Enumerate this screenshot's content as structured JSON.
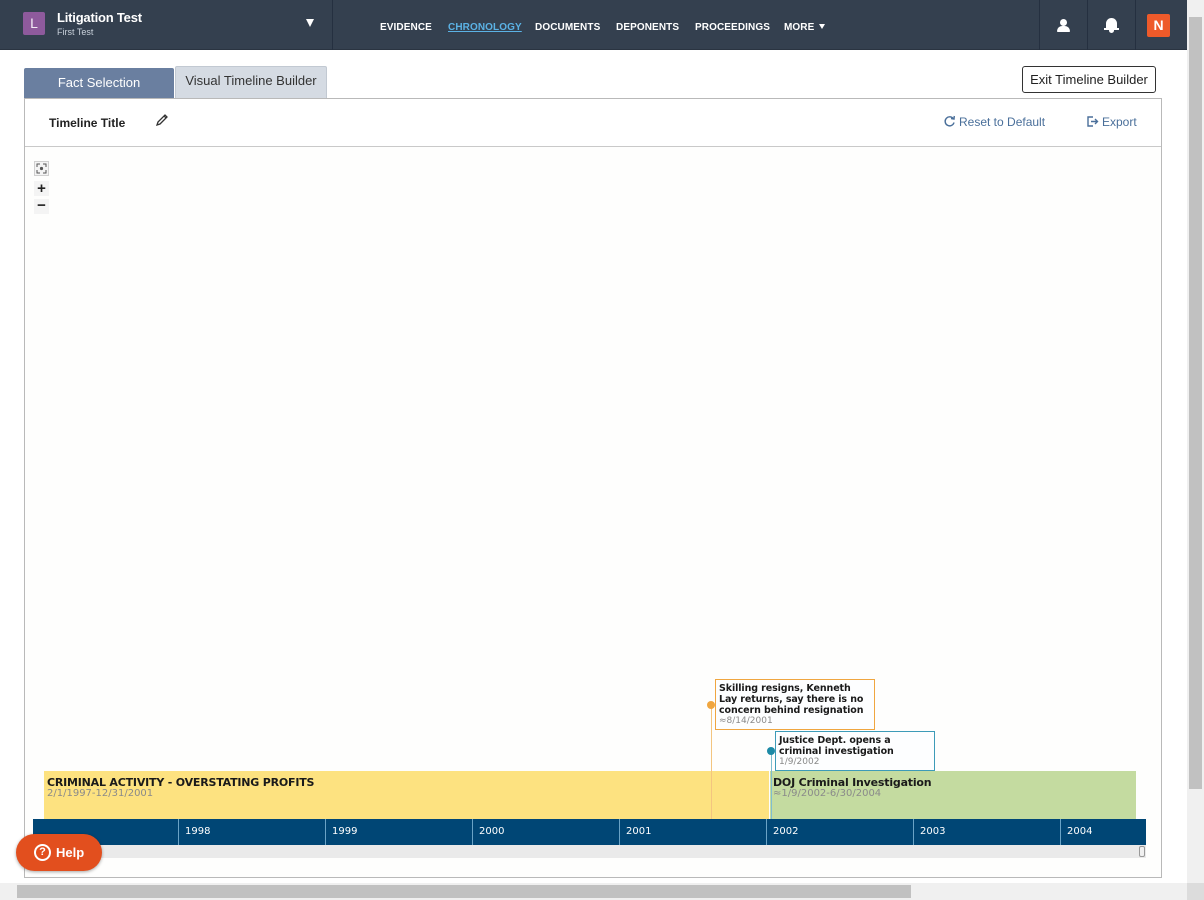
{
  "case": {
    "initial": "L",
    "name": "Litigation Test",
    "subtitle": "First Test"
  },
  "nav": {
    "items": [
      "EVIDENCE",
      "CHRONOLOGY",
      "DOCUMENTS",
      "DEPONENTS",
      "PROCEEDINGS",
      "MORE"
    ],
    "active": "CHRONOLOGY"
  },
  "header_icons": [
    "user-icon",
    "bell-icon",
    "brand-logo-icon"
  ],
  "brand_glyph": "N",
  "tabs": {
    "fact_selection": "Fact Selection",
    "visual_timeline_builder": "Visual Timeline Builder"
  },
  "exit_button": "Exit Timeline Builder",
  "toolbar": {
    "timeline_title": "Timeline Title",
    "reset_label": "Reset to Default",
    "export_label": "Export"
  },
  "zoom": {
    "in_label": "+",
    "out_label": "−"
  },
  "timeline": {
    "axis_years": [
      "1998",
      "1999",
      "2000",
      "2001",
      "2002",
      "2003",
      "2004"
    ],
    "periods": [
      {
        "label": "CRIMINAL ACTIVITY - OVERSTATING PROFITS",
        "dates": "2/1/1997-12/31/2001",
        "color": "#fde280"
      },
      {
        "label": "DOJ Criminal Investigation",
        "dates": "≈1/9/2002-6/30/2004",
        "color": "#c4dba0"
      }
    ],
    "events": [
      {
        "title": "Skilling resigns, Kenneth Lay returns, say there is no concern behind resignation",
        "date": "≈8/14/2001",
        "color": "#f0a640"
      },
      {
        "title": "Justice Dept. opens a criminal investigation",
        "date": "1/9/2002",
        "color": "#1d8aa6"
      }
    ]
  },
  "help_label": "Help",
  "help_glyph": "?",
  "colors": {
    "topbar": "#34404f",
    "active_nav": "#5bb2e5",
    "axis": "#004675",
    "help": "#e24f1e",
    "link": "#4a6f9a"
  }
}
